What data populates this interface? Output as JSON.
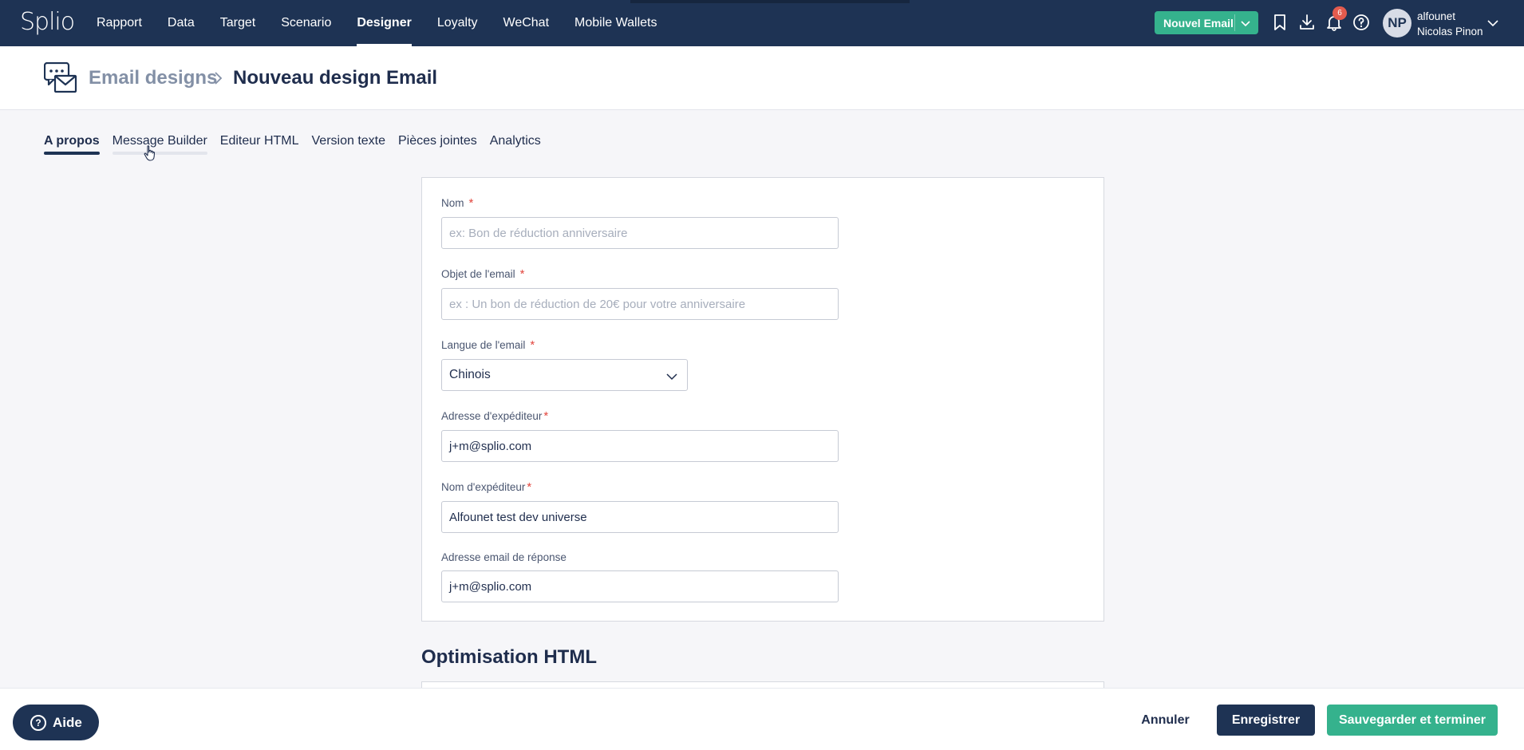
{
  "app": {
    "logo": "Splio"
  },
  "nav": {
    "items": [
      {
        "label": "Rapport",
        "active": false
      },
      {
        "label": "Data",
        "active": false
      },
      {
        "label": "Target",
        "active": false
      },
      {
        "label": "Scenario",
        "active": false
      },
      {
        "label": "Designer",
        "active": true
      },
      {
        "label": "Loyalty",
        "active": false
      },
      {
        "label": "WeChat",
        "active": false
      },
      {
        "label": "Mobile Wallets",
        "active": false
      }
    ],
    "new_email_label": "Nouvel Email",
    "notification_count": "6",
    "user": {
      "initials": "NP",
      "login": "alfounet",
      "name": "Nicolas Pinon"
    }
  },
  "breadcrumb": {
    "parent": "Email designs",
    "current": "Nouveau design Email"
  },
  "tabs": [
    {
      "label": "A propos",
      "state": "active"
    },
    {
      "label": "Message Builder",
      "state": "hover"
    },
    {
      "label": "Editeur HTML",
      "state": ""
    },
    {
      "label": "Version texte",
      "state": ""
    },
    {
      "label": "Pièces jointes",
      "state": ""
    },
    {
      "label": "Analytics",
      "state": ""
    }
  ],
  "form": {
    "nom": {
      "label": "Nom",
      "required": "*",
      "value": "",
      "placeholder": "ex: Bon de réduction anniversaire"
    },
    "objet": {
      "label": "Objet de l'email",
      "required": "*",
      "value": "",
      "placeholder": "ex : Un bon de réduction de 20€ pour votre anniversaire"
    },
    "langue": {
      "label": "Langue de l'email",
      "required": "*",
      "value": "Chinois"
    },
    "adresse_exp": {
      "label": "Adresse d'expéditeur",
      "required": "*",
      "value": "j+m@splio.com"
    },
    "nom_exp": {
      "label": "Nom d'expéditeur",
      "required": "*",
      "value": "Alfounet test dev universe"
    },
    "reponse": {
      "label": "Adresse email de réponse",
      "value": "j+m@splio.com"
    }
  },
  "section": {
    "title": "Optimisation HTML"
  },
  "footer": {
    "help_label": "Aide",
    "cancel_label": "Annuler",
    "save_label": "Enregistrer",
    "finish_label": "Sauvegarder et terminer"
  },
  "colors": {
    "navy": "#1e3354",
    "green": "#35b28d",
    "required": "#e2463e",
    "badge": "#e35b4e"
  },
  "icons": [
    "chevron-down-icon",
    "bookmark-icon",
    "download-icon",
    "bell-icon",
    "help-circle-icon",
    "email-design-icon",
    "chevron-right-icon",
    "pointer-cursor-icon"
  ]
}
